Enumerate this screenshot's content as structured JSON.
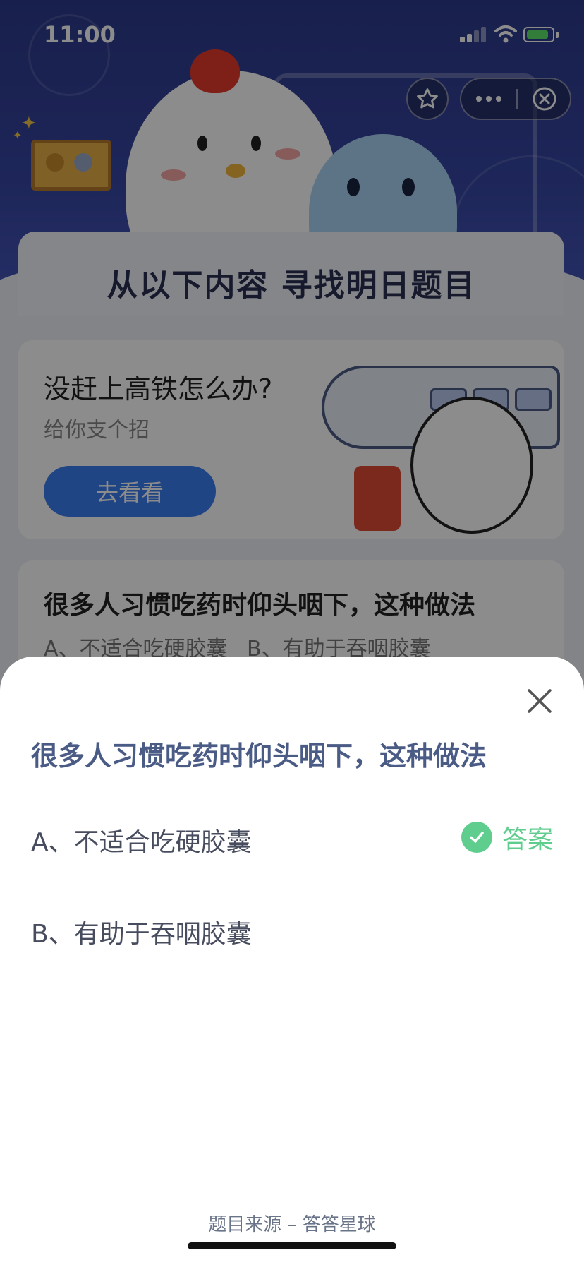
{
  "status_bar": {
    "time": "11:00"
  },
  "capsule": {
    "star_icon": "star-icon",
    "more_icon": "more-dots-icon",
    "close_icon": "close-circle-icon"
  },
  "section": {
    "title": "从以下内容 寻找明日题目"
  },
  "article_card": {
    "title": "没赶上高铁怎么办?",
    "subtitle": "给你支个招",
    "button_label": "去看看"
  },
  "question_card": {
    "title": "很多人习惯吃药时仰头咽下，这种做法",
    "options_text": "A、不适合吃硬胶囊  B、有助于吞咽胶囊"
  },
  "sheet": {
    "question": "很多人习惯吃药时仰头咽下，这种做法",
    "options": [
      {
        "label": "A、不适合吃硬胶囊",
        "is_answer": true
      },
      {
        "label": "B、有助于吞咽胶囊",
        "is_answer": false
      }
    ],
    "answer_label": "答案",
    "source": "题目来源 – 答答星球"
  },
  "colors": {
    "accent_blue": "#3b7ef0",
    "answer_green": "#5fcd8d",
    "question_text": "#4a5b86",
    "hero_bg": "#2d3a8c"
  }
}
